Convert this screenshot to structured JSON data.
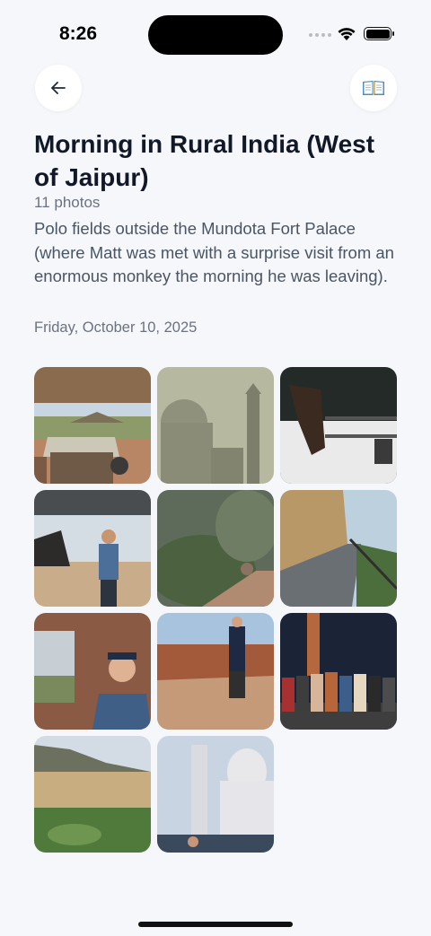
{
  "status_bar": {
    "time": "8:26"
  },
  "header": {
    "back_icon": "arrow-left-icon",
    "book_icon": "open-book-icon"
  },
  "album": {
    "title": "Morning in Rural India (West of Jaipur)",
    "photo_count": "11 photos",
    "description": "Polo fields outside the Mundota Fort Palace (where Matt was met with a surprise visit from an enormous monkey the morning he was leaving).",
    "date": "Friday, October 10, 2025"
  }
}
